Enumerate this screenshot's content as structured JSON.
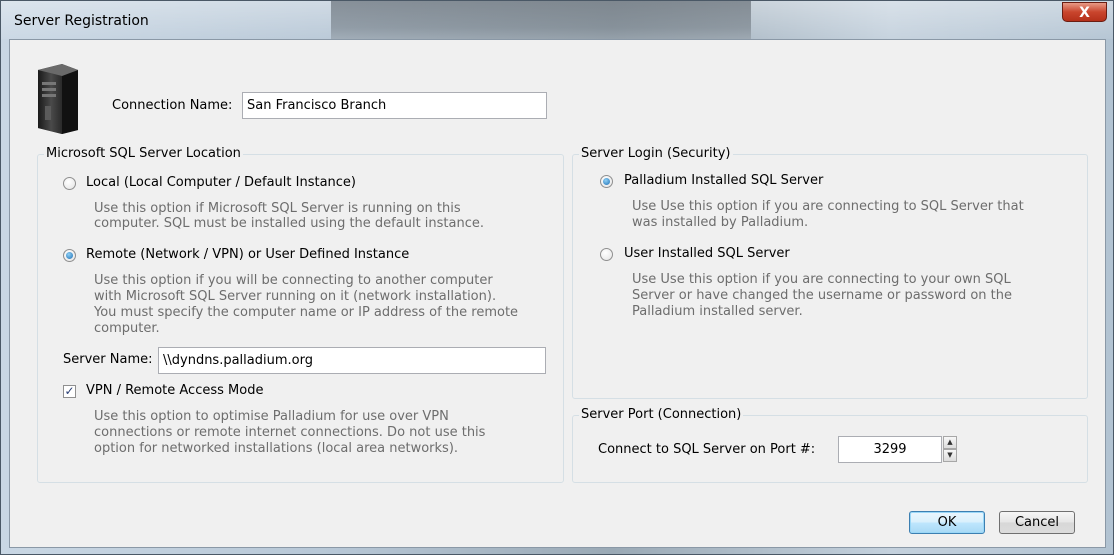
{
  "window": {
    "title": "Server Registration",
    "close_glyph": "X"
  },
  "connection": {
    "label": "Connection Name:",
    "value": "San Francisco Branch"
  },
  "location_group": {
    "title": "Microsoft SQL Server Location",
    "local": {
      "label": "Local (Local Computer / Default Instance)",
      "desc1": "Use this option if Microsoft SQL Server is running on this",
      "desc2": "computer. SQL must be installed using the default instance.",
      "selected": false
    },
    "remote": {
      "label": "Remote (Network / VPN) or User Defined Instance",
      "desc1": "Use this option if you will be connecting to another computer",
      "desc2": "with Microsoft SQL Server running on it (network installation).",
      "desc3": "You must specify the computer name or IP address of the remote",
      "desc4": "computer.",
      "selected": true
    },
    "server_name": {
      "label": "Server Name:",
      "value": "\\\\dyndns.palladium.org"
    },
    "vpn": {
      "label": "VPN / Remote Access Mode",
      "checked": true,
      "check_glyph": "✓",
      "desc1": "Use this option to optimise Palladium for use over VPN",
      "desc2": "connections or remote internet connections. Do not use this",
      "desc3": "option for networked installations (local area networks)."
    }
  },
  "login_group": {
    "title": "Server Login (Security)",
    "palladium": {
      "label": "Palladium Installed SQL Server",
      "desc1": "Use Use this option if you are connecting to SQL Server that",
      "desc2": "was installed by Palladium.",
      "selected": true
    },
    "user": {
      "label": "User Installed SQL Server",
      "desc1": "Use Use this option if you are connecting to your own SQL",
      "desc2": "Server or have changed the username or password on the",
      "desc3": "Palladium installed server.",
      "selected": false
    }
  },
  "port_group": {
    "title": "Server Port (Connection)",
    "label": "Connect to SQL Server on Port #:",
    "value": "3299",
    "up_glyph": "▲",
    "down_glyph": "▼"
  },
  "buttons": {
    "ok": "OK",
    "cancel": "Cancel"
  },
  "icons": {
    "server": "server-tower-icon"
  }
}
